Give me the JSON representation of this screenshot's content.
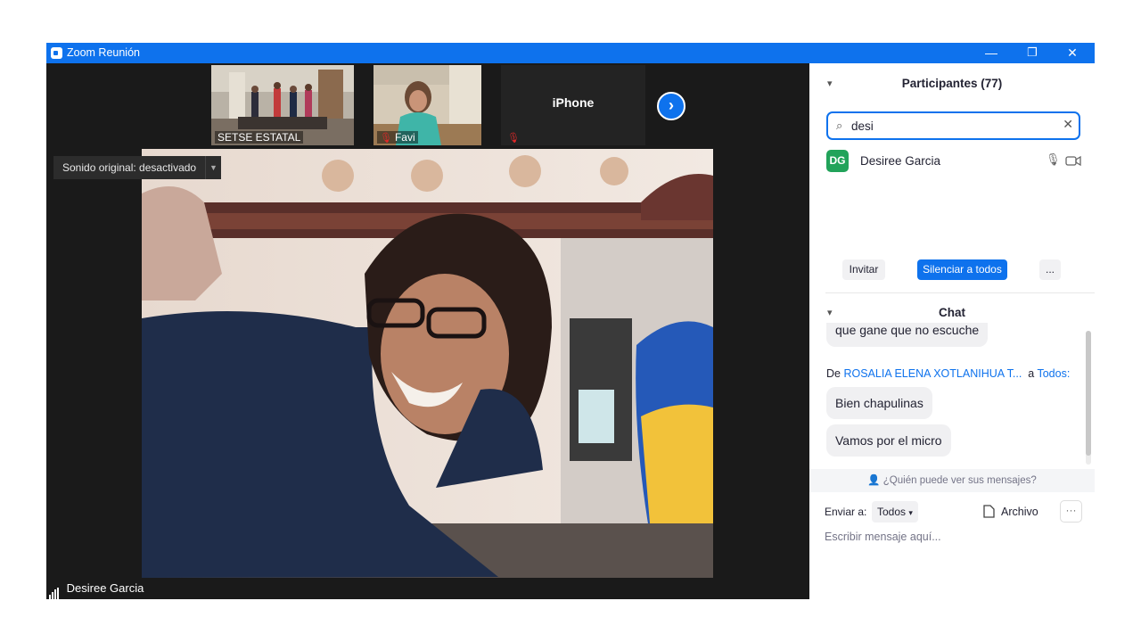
{
  "window": {
    "title": "Zoom Reunión",
    "minimize_icon": "—",
    "restore_icon": "❐",
    "close_icon": "✕"
  },
  "thumbnails": [
    {
      "label": "SETSE ESTATAL"
    },
    {
      "label": "Favi"
    },
    {
      "label": "iPhone"
    }
  ],
  "video": {
    "sound_original": "Sonido original: desactivado",
    "active_speaker": "Desiree Garcia"
  },
  "participants": {
    "title": "Participantes (77)",
    "search_value": "desi",
    "list": [
      {
        "initials": "DG",
        "name": "Desiree Garcia",
        "avatar_color": "#22a35a"
      }
    ],
    "invite_label": "Invitar",
    "mute_all_label": "Silenciar a todos",
    "more_label": "..."
  },
  "chat": {
    "title": "Chat",
    "messages_top": [
      {
        "text": "que gane que no escuche"
      }
    ],
    "from_prefix": "De",
    "from_name": "ROSALIA ELENA XOTLANIHUA T...",
    "to_prefix": "a",
    "to_name": "Todos:",
    "messages": [
      {
        "text": "Bien chapulinas"
      },
      {
        "text": "Vamos por el micro"
      }
    ],
    "who_can_see": "¿Quién puede ver sus mensajes?",
    "send_to_label": "Enviar a:",
    "send_to_value": "Todos",
    "file_label": "Archivo",
    "more_label": "···",
    "input_placeholder": "Escribir mensaje aquí..."
  },
  "colors": {
    "accent": "#0e72ed",
    "avatar_green": "#22a35a",
    "mute_red": "#e02828"
  }
}
